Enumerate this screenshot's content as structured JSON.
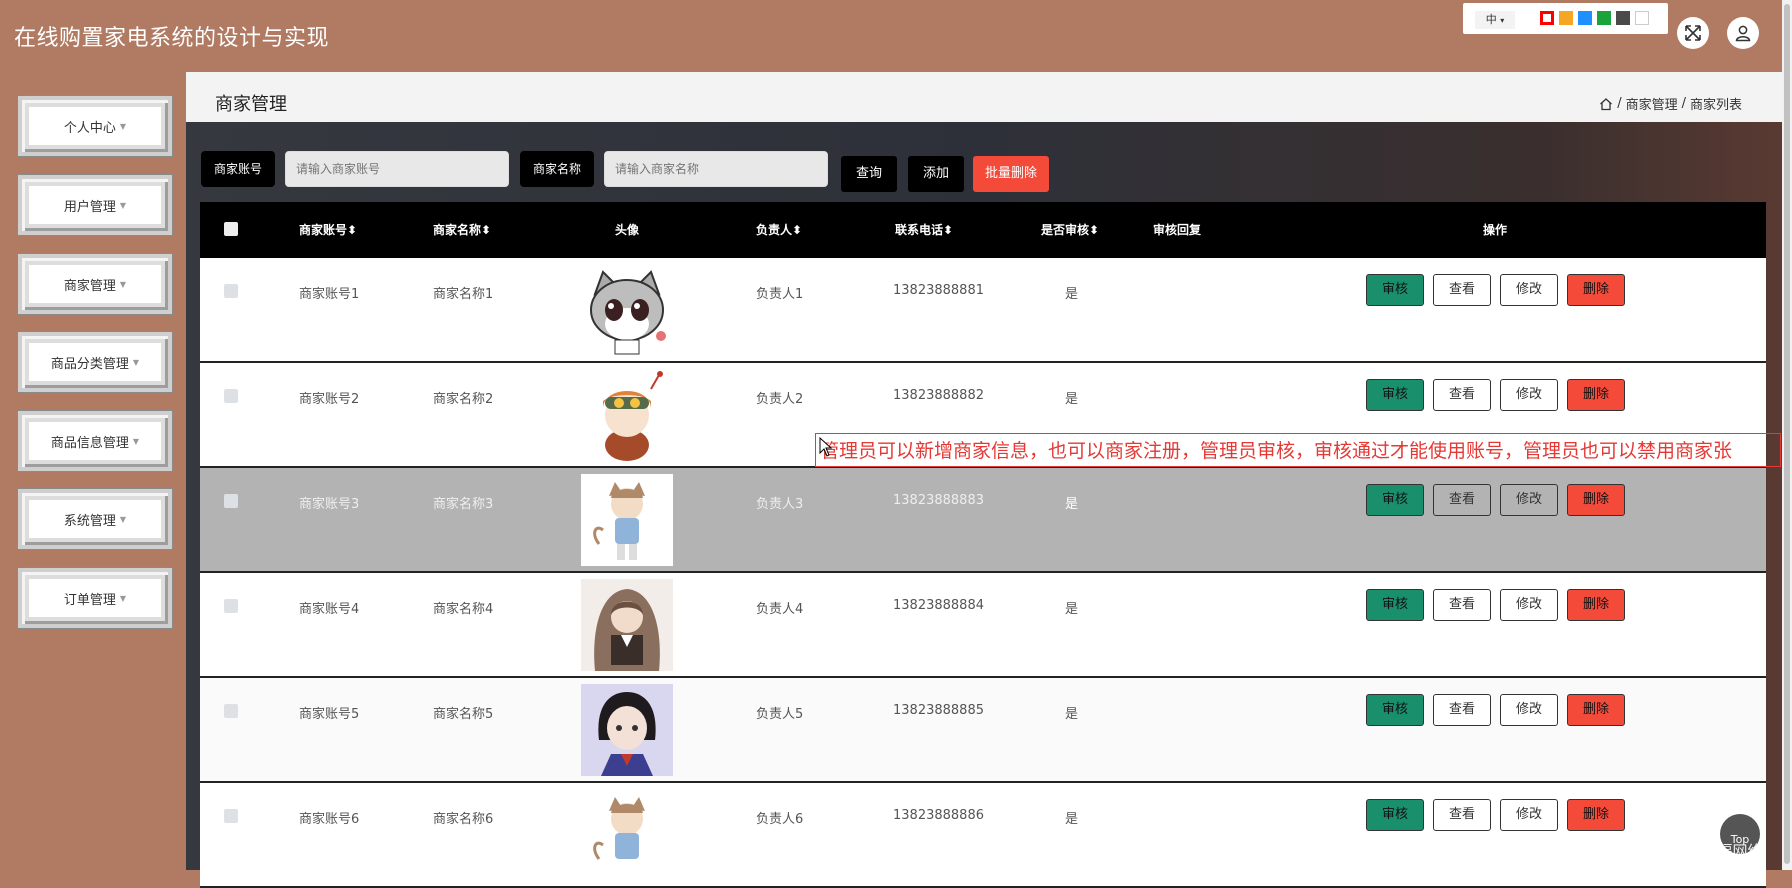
{
  "app": {
    "title": "在线购置家电系统的设计与实现"
  },
  "theme": {
    "lang": "中",
    "lang_caret": "▾",
    "swatches": [
      "#ff0000",
      "#f5a623",
      "#1e90ff",
      "#1aa33a",
      "#4a4a4a",
      "#ffffff"
    ]
  },
  "sidebar": {
    "items": [
      {
        "label": "个人中心"
      },
      {
        "label": "用户管理"
      },
      {
        "label": "商家管理"
      },
      {
        "label": "商品分类管理"
      },
      {
        "label": "商品信息管理"
      },
      {
        "label": "系统管理"
      },
      {
        "label": "订单管理"
      }
    ]
  },
  "page": {
    "title": "商家管理",
    "breadcrumb": {
      "sep": "/",
      "level1": "商家管理",
      "level2": "商家列表"
    }
  },
  "search": {
    "account_label": "商家账号",
    "account_placeholder": "请输入商家账号",
    "name_label": "商家名称",
    "name_placeholder": "请输入商家名称",
    "query": "查询",
    "add": "添加",
    "batch_delete": "批量删除"
  },
  "table": {
    "columns": [
      "商家账号",
      "商家名称",
      "头像",
      "负责人",
      "联系电话",
      "是否审核",
      "审核回复",
      "操作"
    ],
    "sort_glyph": "⬍",
    "actions": {
      "review": "审核",
      "view": "查看",
      "edit": "修改",
      "delete": "删除"
    },
    "rows": [
      {
        "account": "商家账号1",
        "name": "商家名称1",
        "owner": "负责人1",
        "phone": "13823888881",
        "reviewed": "是",
        "reply": ""
      },
      {
        "account": "商家账号2",
        "name": "商家名称2",
        "owner": "负责人2",
        "phone": "13823888882",
        "reviewed": "是",
        "reply": ""
      },
      {
        "account": "商家账号3",
        "name": "商家名称3",
        "owner": "负责人3",
        "phone": "13823888883",
        "reviewed": "是",
        "reply": ""
      },
      {
        "account": "商家账号4",
        "name": "商家名称4",
        "owner": "负责人4",
        "phone": "13823888884",
        "reviewed": "是",
        "reply": ""
      },
      {
        "account": "商家账号5",
        "name": "商家名称5",
        "owner": "负责人5",
        "phone": "13823888885",
        "reviewed": "是",
        "reply": ""
      },
      {
        "account": "商家账号6",
        "name": "商家名称6",
        "owner": "负责人6",
        "phone": "13823888886",
        "reviewed": "是",
        "reply": ""
      }
    ]
  },
  "note": "管理员可以新增商家信息，也可以商家注册，管理员审核，审核通过才能使用账号，管理员也可以禁用商家张",
  "top_button": "Top",
  "watermark": "CSDN @幸福网络",
  "colors": {
    "accent_green": "#1a8f6c",
    "danger": "#f44a3a",
    "header_bg": "#b07a63"
  }
}
